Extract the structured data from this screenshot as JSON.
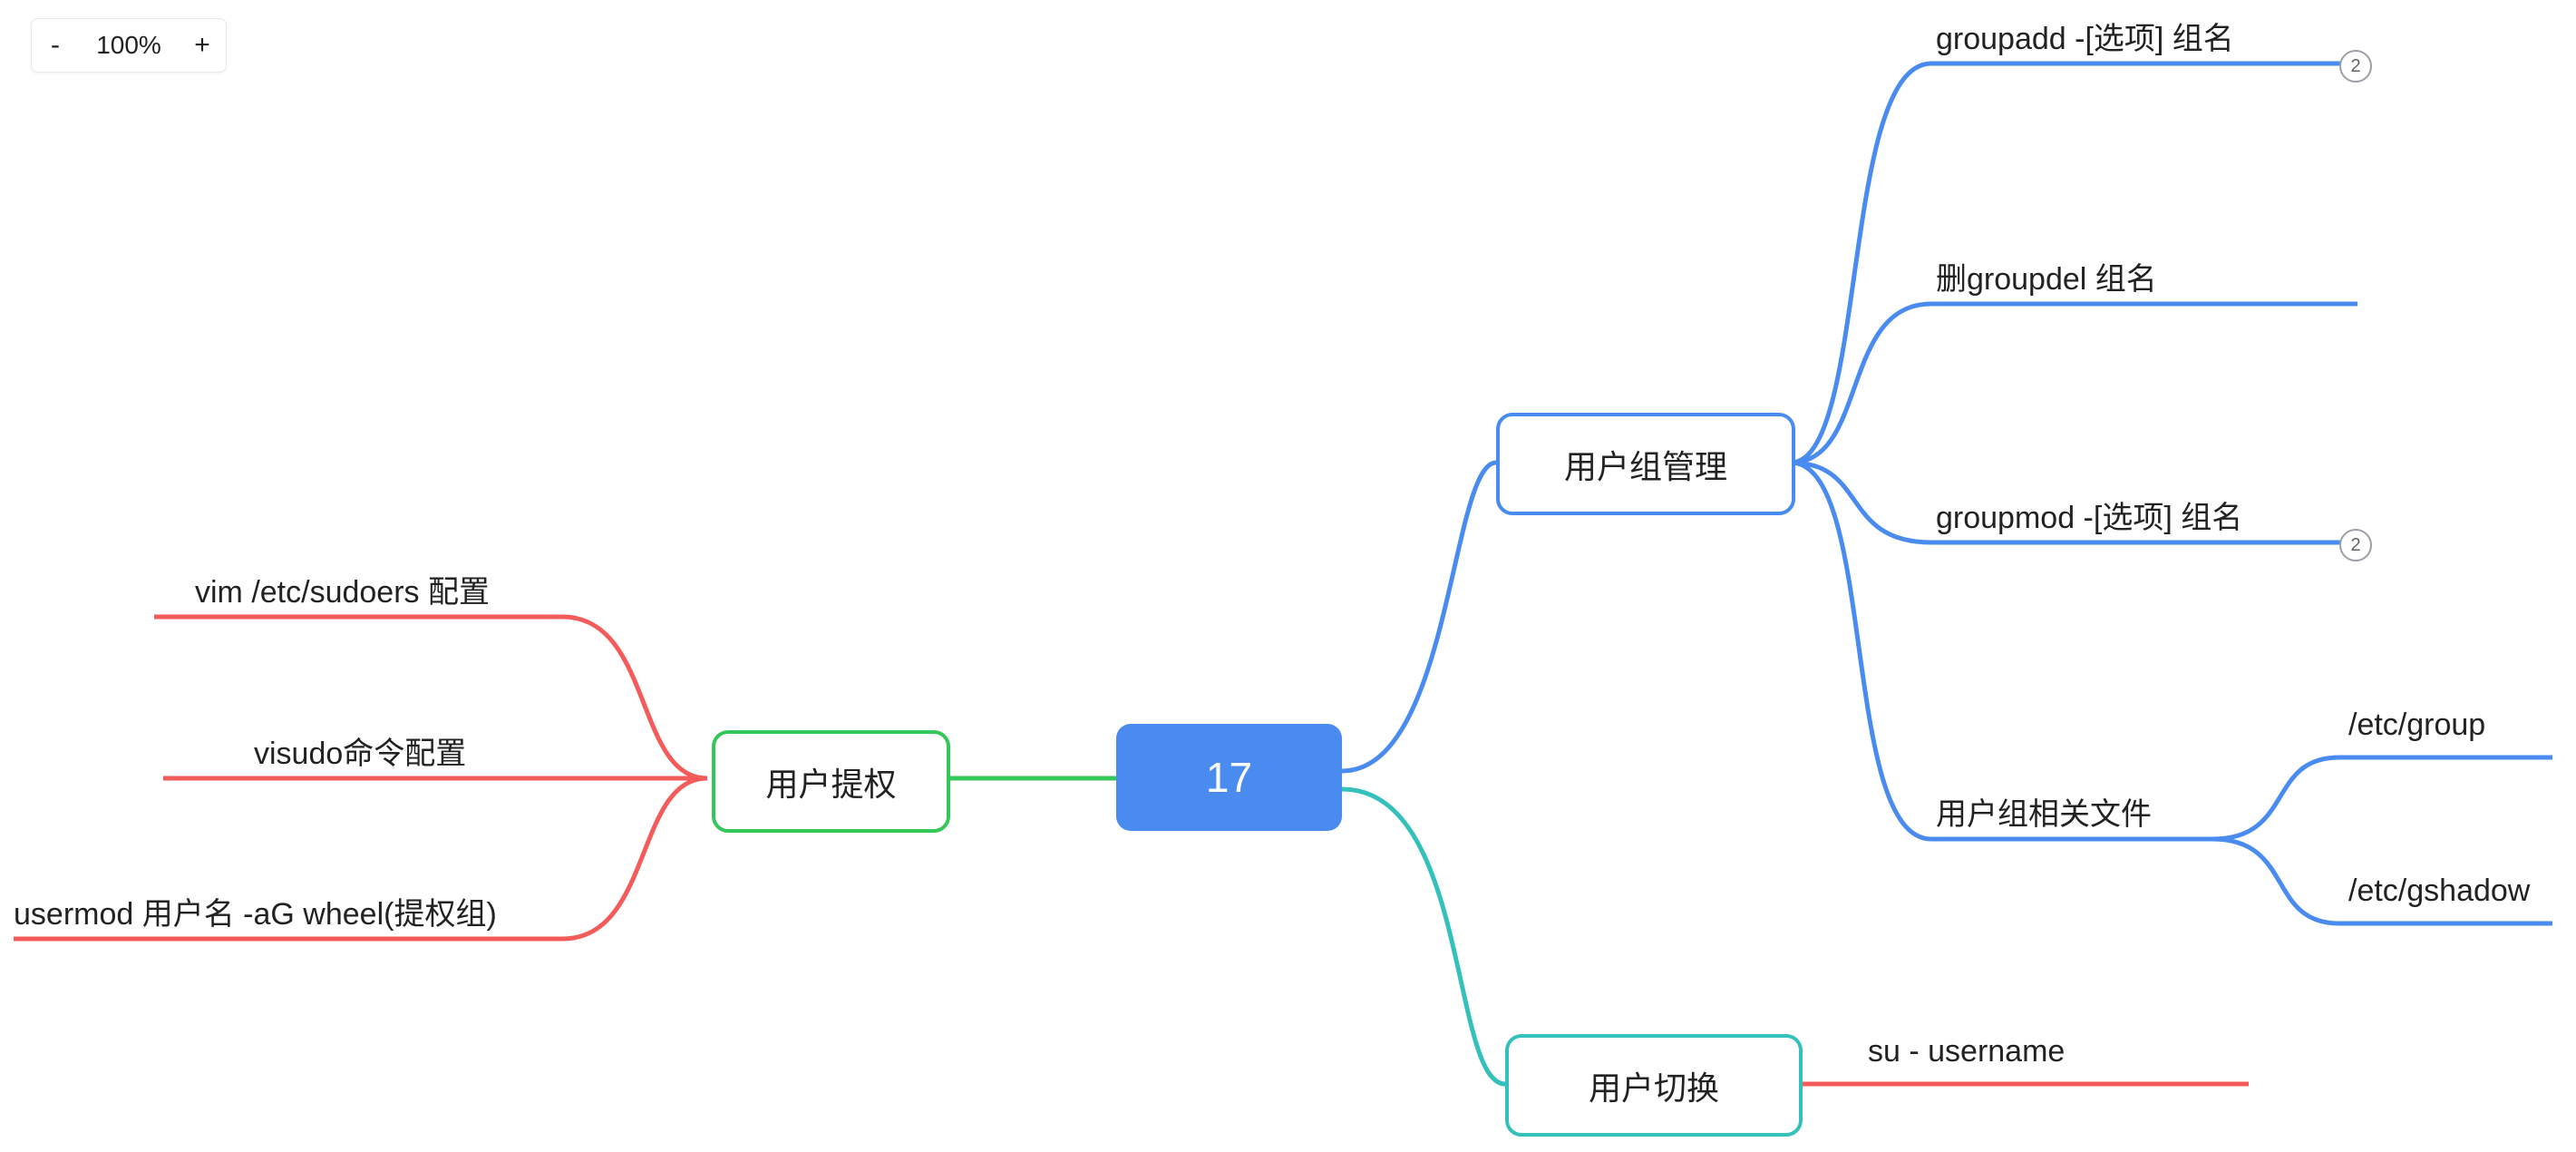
{
  "zoom": {
    "minus": "-",
    "value": "100%",
    "plus": "+"
  },
  "root": {
    "label": "17"
  },
  "branches": {
    "group_mgmt": {
      "label": "用户组管理"
    },
    "user_switch": {
      "label": "用户切换"
    },
    "user_priv": {
      "label": "用户提权"
    }
  },
  "leaves": {
    "groupadd": {
      "label": "groupadd -[选项] 组名",
      "badge": "2"
    },
    "groupdel": {
      "label": "删groupdel 组名"
    },
    "groupmod": {
      "label": "groupmod -[选项] 组名",
      "badge": "2"
    },
    "groupfiles": {
      "label": "用户组相关文件"
    },
    "etc_group": {
      "label": "/etc/group"
    },
    "etc_gshadow": {
      "label": "/etc/gshadow"
    },
    "su": {
      "label": "su - username"
    },
    "sudoers": {
      "label": "vim /etc/sudoers 配置"
    },
    "visudo": {
      "label": "visudo命令配置"
    },
    "usermod": {
      "label": "usermod 用户名 -aG wheel(提权组)"
    }
  },
  "colors": {
    "blue": "#4a8bf0",
    "teal": "#34c0bb",
    "green": "#34c759",
    "red": "#f45b5b"
  }
}
